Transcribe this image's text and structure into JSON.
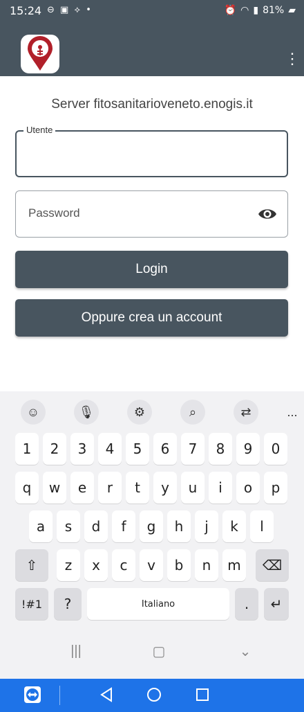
{
  "status_bar": {
    "time": "15:24",
    "left_icons": [
      "remote-control-icon",
      "image-icon",
      "signal-icon"
    ],
    "battery": "81%",
    "right_icons": [
      "alarm-icon",
      "wifi-icon",
      "signal-bars-icon",
      "battery-icon"
    ]
  },
  "app_bar": {
    "logo": "app-logo-pin",
    "menu_icon": "more-vert-icon"
  },
  "login": {
    "server_text": "Server fitosanitarioveneto.enogis.it",
    "user_label": "Utente",
    "user_value": "",
    "password_placeholder": "Password",
    "password_icon": "eye-icon",
    "login_button": "Login",
    "create_account_button": "Oppure crea un account"
  },
  "keyboard": {
    "toolbar": [
      "emoji-icon",
      "mic-icon",
      "settings-icon",
      "search-icon",
      "translate-icon",
      "more-icon"
    ],
    "toolbar_more": "...",
    "row_numbers": [
      "1",
      "2",
      "3",
      "4",
      "5",
      "6",
      "7",
      "8",
      "9",
      "0"
    ],
    "row_1": [
      "q",
      "w",
      "e",
      "r",
      "t",
      "y",
      "u",
      "i",
      "o",
      "p"
    ],
    "row_2": [
      "a",
      "s",
      "d",
      "f",
      "g",
      "h",
      "j",
      "k",
      "l"
    ],
    "row_3": [
      "z",
      "x",
      "c",
      "v",
      "b",
      "n",
      "m"
    ],
    "symbols_key": "!#1",
    "question_key": "?",
    "space_label": "Italiano",
    "period_key": ".",
    "nav": [
      "recent-apps-icon",
      "home-icon",
      "back-chevron-icon"
    ]
  },
  "bottom_bar": {
    "color": "#1e73e8",
    "icons": [
      "teamviewer-icon",
      "back-icon",
      "home-circle-icon",
      "overview-square-icon"
    ]
  },
  "colors": {
    "primary": "#48555f",
    "keyboard_bg": "#f2f2f4"
  }
}
